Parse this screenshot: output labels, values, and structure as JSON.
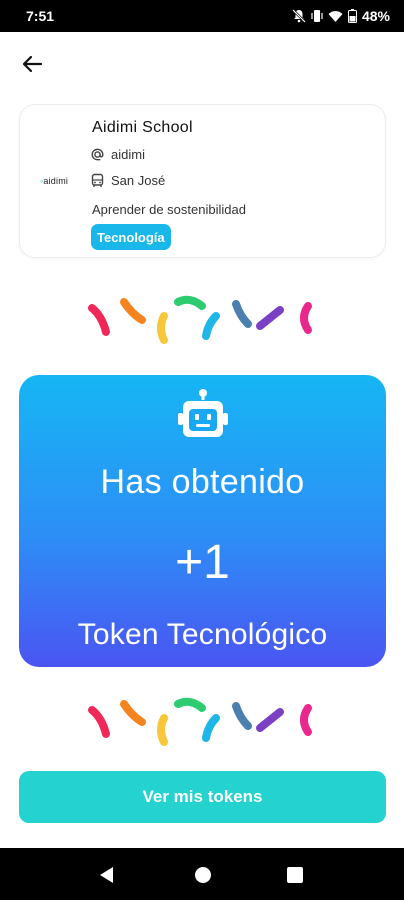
{
  "status_bar": {
    "time": "7:51",
    "battery": "48%"
  },
  "icons": {
    "back": "arrow-left-icon",
    "handle": "at-icon",
    "location": "bus-icon",
    "robot": "robot-icon"
  },
  "school": {
    "logo_text": "aidimi",
    "name": "Aidimi School",
    "handle": "aidimi",
    "location": "San José",
    "description": "Aprender de sostenibilidad",
    "category": "Tecnología"
  },
  "reward": {
    "title": "Has obtenido",
    "amount": "+1",
    "token_type": "Token Tecnológico"
  },
  "cta": {
    "label": "Ver mis tokens"
  },
  "colors": {
    "accent_teal": "#24d3cf",
    "badge_blue": "#19b7ea",
    "gradient_top": "#16b6f4",
    "gradient_bottom": "#4a55f2",
    "confetti": [
      "#f0285a",
      "#f5841f",
      "#f8c63b",
      "#2ecc71",
      "#1fb6e8",
      "#4a7fb0",
      "#7b3fc4",
      "#e8288c"
    ]
  }
}
